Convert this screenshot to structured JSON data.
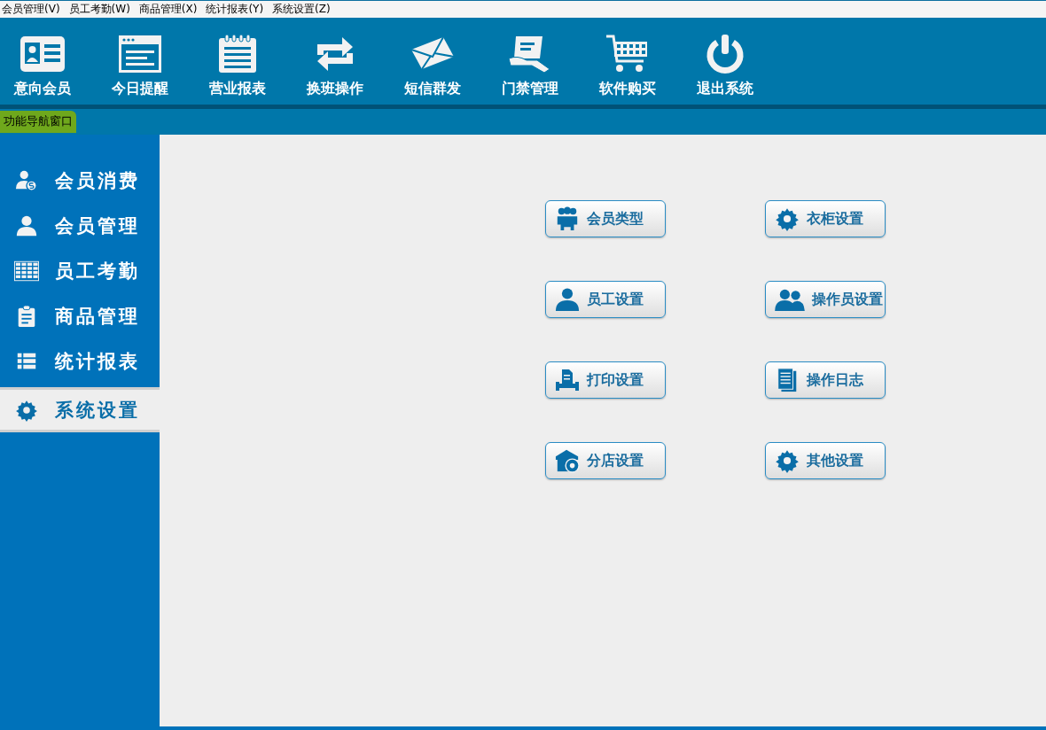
{
  "menu_bar": [
    {
      "label": "会员管理(V)"
    },
    {
      "label": "员工考勤(W)"
    },
    {
      "label": "商品管理(X)"
    },
    {
      "label": "统计报表(Y)"
    },
    {
      "label": "系统设置(Z)"
    }
  ],
  "toolbar": [
    {
      "label": "意向会员",
      "kind": "card"
    },
    {
      "label": "今日提醒",
      "kind": "window"
    },
    {
      "label": "营业报表",
      "kind": "notepad"
    },
    {
      "label": "换班操作",
      "kind": "swap"
    },
    {
      "label": "短信群发",
      "kind": "mail"
    },
    {
      "label": "门禁管理",
      "kind": "hand"
    },
    {
      "label": "软件购买",
      "kind": "cart"
    },
    {
      "label": "退出系统",
      "kind": "power"
    }
  ],
  "nav_tab": {
    "label": "功能导航窗口"
  },
  "sidebar": {
    "items": [
      {
        "label": "会员消费",
        "kind": "payer",
        "selected": false
      },
      {
        "label": "会员管理",
        "kind": "user",
        "selected": false
      },
      {
        "label": "员工考勤",
        "kind": "grid",
        "selected": false
      },
      {
        "label": "商品管理",
        "kind": "clipboard",
        "selected": false
      },
      {
        "label": "统计报表",
        "kind": "list",
        "selected": false
      },
      {
        "label": "系统设置",
        "kind": "gear",
        "selected": true
      }
    ]
  },
  "settings_buttons": [
    {
      "label": "会员类型",
      "kind": "group"
    },
    {
      "label": "衣柜设置",
      "kind": "gear"
    },
    {
      "label": "员工设置",
      "kind": "user"
    },
    {
      "label": "操作员设置",
      "kind": "users"
    },
    {
      "label": "打印设置",
      "kind": "printer"
    },
    {
      "label": "操作日志",
      "kind": "document"
    },
    {
      "label": "分店设置",
      "kind": "store"
    },
    {
      "label": "其他设置",
      "kind": "gear"
    }
  ]
}
